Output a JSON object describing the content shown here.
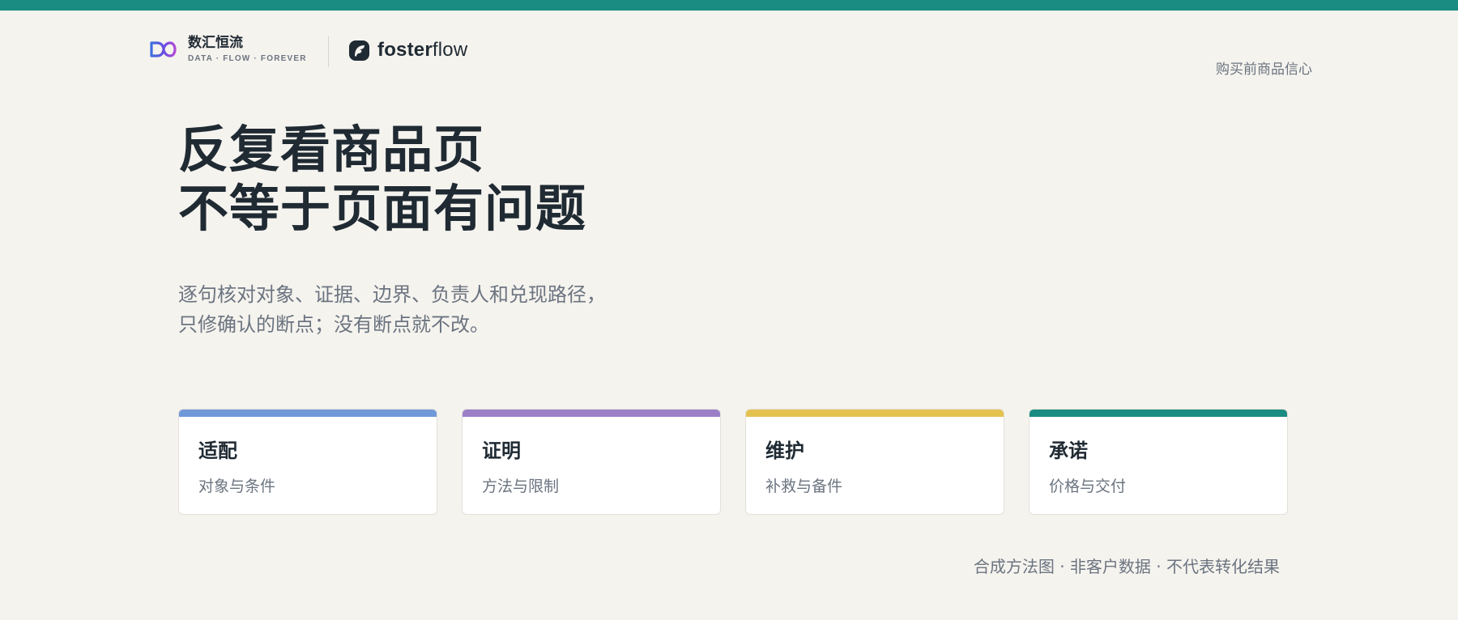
{
  "brand": {
    "name": "数汇恒流",
    "tagline": "DATA · FLOW · FOREVER",
    "logo_icon": "infinity-gradient-icon"
  },
  "partner": {
    "name_bold": "foster",
    "name_regular": "flow",
    "logo_icon": "fosterflow-leaf-icon"
  },
  "nav": {
    "link_label": "购买前商品信心"
  },
  "hero": {
    "line1": "反复看商品页",
    "line2": "不等于页面有问题"
  },
  "subtitle": {
    "line1": "逐句核对对象、证据、边界、负责人和兑现路径，",
    "line2": "只修确认的断点；没有断点就不改。"
  },
  "cards": [
    {
      "title": "适配",
      "subtitle": "对象与条件",
      "accent": "#7099D8"
    },
    {
      "title": "证明",
      "subtitle": "方法与限制",
      "accent": "#9B80C8"
    },
    {
      "title": "维护",
      "subtitle": "补救与备件",
      "accent": "#E4C24F"
    },
    {
      "title": "承诺",
      "subtitle": "价格与交付",
      "accent": "#1B8C82"
    }
  ],
  "footnote": "合成方法图 · 非客户数据 · 不代表转化结果",
  "colors": {
    "top_bar": "#1B8C82",
    "background": "#F5F3EE",
    "text_primary": "#1F2A33",
    "text_secondary": "#6B7480"
  }
}
